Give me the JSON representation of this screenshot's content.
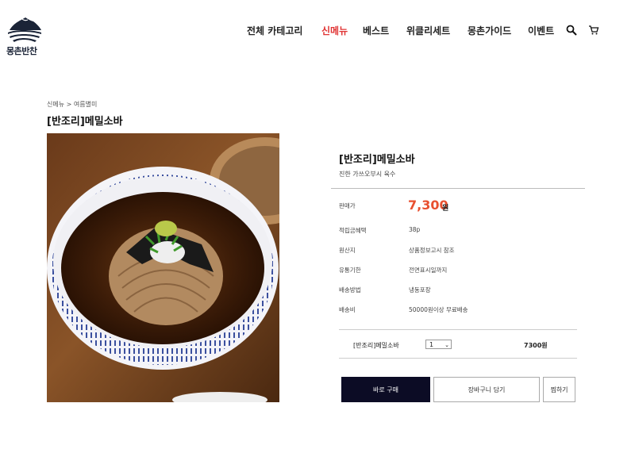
{
  "brand": {
    "logo_text": "몽촌반찬"
  },
  "nav": {
    "items": [
      {
        "label": "전체 카테고리",
        "active": false
      },
      {
        "label": "신메뉴",
        "active": true
      },
      {
        "label": "베스트",
        "active": false
      },
      {
        "label": "위클리세트",
        "active": false
      },
      {
        "label": "몽촌가이드",
        "active": false
      },
      {
        "label": "이벤트",
        "active": false
      }
    ],
    "icons": [
      "search-icon",
      "cart-icon"
    ],
    "active_color": "#e03434"
  },
  "breadcrumb": "신메뉴 > 여름별미",
  "page_title": "[반조리]메밀소바",
  "product": {
    "name": "[반조리]메밀소바",
    "subtitle": "진한 가쓰오부시 육수",
    "price_label": "판매가",
    "price": "7,300",
    "price_unit": "원",
    "price_color": "#e8502f",
    "details": [
      {
        "label": "적립금혜택",
        "value": "38p"
      },
      {
        "label": "원산지",
        "value": "상품정보고시 참조"
      },
      {
        "label": "유통기한",
        "value": "전면표시일까지"
      },
      {
        "label": "배송방법",
        "value": "냉동포장"
      },
      {
        "label": "배송비",
        "value": "50000원이상 무료배송"
      }
    ]
  },
  "option": {
    "name": "[반조리]메밀소바",
    "quantity": "1",
    "price": "7300원"
  },
  "buttons": {
    "buy": "바로 구매",
    "cart": "장바구니 담기",
    "wish": "찜하기",
    "buy_color": "#0c0c25"
  }
}
